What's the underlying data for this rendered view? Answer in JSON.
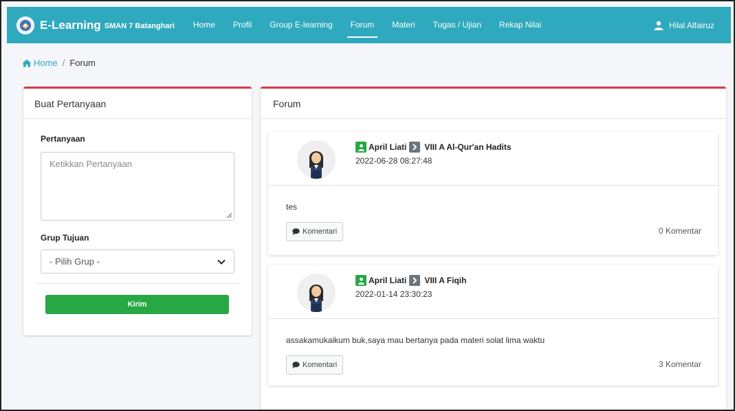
{
  "navbar": {
    "brand_name": "E-Learning",
    "brand_sub": "SMAN 7 Batanghari",
    "items": [
      {
        "label": "Home"
      },
      {
        "label": "Profil"
      },
      {
        "label": "Group E-learning"
      },
      {
        "label": "Forum",
        "active": true
      },
      {
        "label": "Materi"
      },
      {
        "label": "Tugas / Ujian"
      },
      {
        "label": "Rekap Nilai"
      }
    ],
    "user_name": "Hilal Alfairuz",
    "color": "#2fa9bd"
  },
  "breadcrumb": {
    "home": "Home",
    "separator": "/",
    "current": "Forum"
  },
  "form": {
    "title": "Buat Pertanyaan",
    "question_label": "Pertanyaan",
    "question_placeholder": "Ketikkan Pertanyaan",
    "group_label": "Grup Tujuan",
    "group_selected": "- Pilih Grup -",
    "submit_label": "Kirim"
  },
  "forum": {
    "title": "Forum",
    "posts": [
      {
        "author": "April Liati",
        "group": "VIII A Al-Qur'an Hadits",
        "date": "2022-06-28 08:27:48",
        "body": "tes",
        "comment_button": "Komentari",
        "comment_count": "0 Komentar"
      },
      {
        "author": "April Liati",
        "group": "VIII A Fiqih",
        "date": "2022-01-14 23:30:23",
        "body": "assakamukaikum buk,saya mau bertanya pada materi solat lima waktu",
        "comment_button": "Komentari",
        "comment_count": "3 Komentar"
      }
    ]
  },
  "colors": {
    "accent": "#2fa9bd",
    "card_top_border": "#d33a4a",
    "success": "#27a844"
  }
}
